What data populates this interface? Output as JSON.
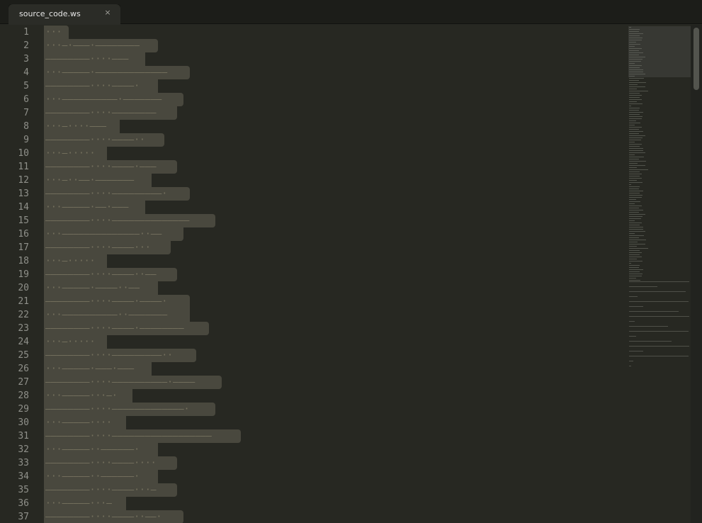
{
  "tab": {
    "title": "source_code.ws",
    "close_glyph": "×"
  },
  "colors": {
    "background": "#272822",
    "selection": "#49483e",
    "line_number": "#8f908a",
    "whitespace_marker": "#75715e"
  },
  "editor": {
    "line_numbers": [
      "1",
      "2",
      "3",
      "4",
      "5",
      "6",
      "7",
      "8",
      "9",
      "10",
      "11",
      "12",
      "13",
      "14",
      "15",
      "16",
      "17",
      "18",
      "19",
      "20",
      "21",
      "22",
      "23",
      "24",
      "25",
      "26",
      "27",
      "28",
      "29",
      "30",
      "31",
      "32",
      "33",
      "34",
      "35",
      "36",
      "37"
    ],
    "lines": [
      "···",
      "···—·———·————————",
      "————————····———",
      "···—————·—————————————",
      "————————····————·",
      "···——————————·———————",
      "————————····————————",
      "···—····———",
      "————————····————··",
      "···—·····",
      "————————····————·———",
      "···—··——·———————",
      "————————····—————————·",
      "···—————·——·———",
      "————————····——————————————",
      "···——————————————··——",
      "————————····————···",
      "···—·····",
      "————————····————··——",
      "···—————·————··——",
      "————————····————·————·",
      "···——————————··———————",
      "————————····————·————————",
      "···—·····",
      "————————····—————————··",
      "···—————·———·———",
      "————————····——————————·————",
      "···—————···—·",
      "————————····—————————————·",
      "···—————····",
      "————————····——————————————————",
      "···—————··——————·",
      "————————····————····",
      "···—————··——————·",
      "————————····————···—",
      "···—————···—",
      "————————····————··——·"
    ]
  },
  "minimap": {
    "label": "minimap"
  },
  "scrollbar": {
    "label": "vertical-scrollbar"
  }
}
